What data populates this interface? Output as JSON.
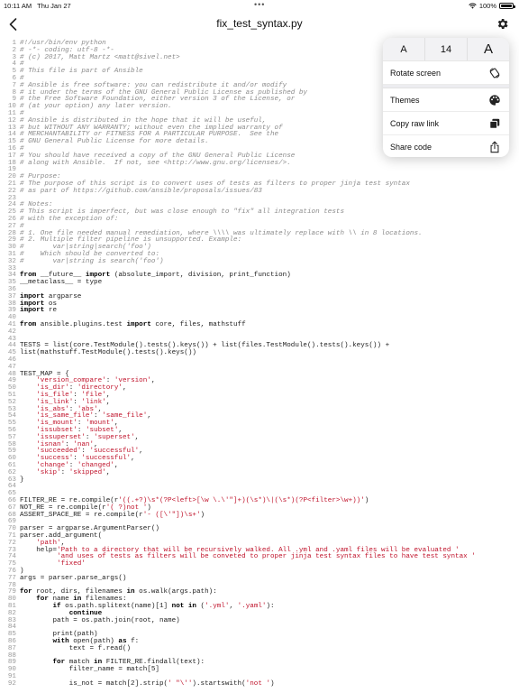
{
  "status_bar": {
    "time": "10:11 AM",
    "date": "Thu Jan 27",
    "battery": "100%"
  },
  "nav": {
    "title": "fix_test_syntax.py"
  },
  "settings_menu": {
    "font_decrease": "A",
    "font_size": "14",
    "font_increase": "A",
    "rotate": "Rotate screen",
    "themes": "Themes",
    "copy_raw": "Copy raw link",
    "share": "Share code"
  },
  "code": {
    "lines": [
      "#!/usr/bin/env python",
      "# -*- coding: utf-8 -*-",
      "# (c) 2017, Matt Martz <matt@sivel.net>",
      "#",
      "# This file is part of Ansible",
      "#",
      "# Ansible is free software: you can redistribute it and/or modify",
      "# it under the terms of the GNU General Public License as published by",
      "# the Free Software Foundation, either version 3 of the License, or",
      "# (at your option) any later version.",
      "#",
      "# Ansible is distributed in the hope that it will be useful,",
      "# but WITHOUT ANY WARRANTY; without even the implied warranty of",
      "# MERCHANTABILITY or FITNESS FOR A PARTICULAR PURPOSE.  See the",
      "# GNU General Public License for more details.",
      "#",
      "# You should have received a copy of the GNU General Public License",
      "# along with Ansible.  If not, see <http://www.gnu.org/licenses/>.",
      "",
      "# Purpose:",
      "# The purpose of this script is to convert uses of tests as filters to proper jinja test syntax",
      "# as part of https://github.com/ansible/proposals/issues/83",
      "",
      "# Notes:",
      "# This script is imperfect, but was close enough to \"fix\" all integration tests",
      "# with the exception of:",
      "#",
      "# 1. One file needed manual remediation, where \\\\\\\\ was ultimately replace with \\\\ in 8 locations.",
      "# 2. Multiple filter pipeline is unsupported. Example:",
      "#       var|string|search('foo')",
      "#    Which should be converted to:",
      "#       var|string is search('foo')",
      "",
      "from __future__ import (absolute_import, division, print_function)",
      "__metaclass__ = type",
      "",
      "import argparse",
      "import os",
      "import re",
      "",
      "from ansible.plugins.test import core, files, mathstuff",
      "",
      "",
      "TESTS = list(core.TestModule().tests().keys()) + list(files.TestModule().tests().keys()) +",
      "list(mathstuff.TestModule().tests().keys())",
      "",
      "",
      "TEST_MAP = {",
      "    'version_compare': 'version',",
      "    'is_dir': 'directory',",
      "    'is_file': 'file',",
      "    'is_link': 'link',",
      "    'is_abs': 'abs',",
      "    'is_same_file': 'same_file',",
      "    'is_mount': 'mount',",
      "    'issubset': 'subset',",
      "    'issuperset': 'superset',",
      "    'isnan': 'nan',",
      "    'succeeded': 'successful',",
      "    'success': 'successful',",
      "    'change': 'changed',",
      "    'skip': 'skipped',",
      "}",
      "",
      "",
      "FILTER_RE = re.compile(r'((.+?)\\s*(?P<left>[\\w \\.\\'\"]+)(\\s*)\\|(\\s*)(?P<filter>\\w+))')",
      "NOT_RE = re.compile(r'( ?)not ')",
      "ASSERT_SPACE_RE = re.compile(r'- ([\\'\"])\\s+')",
      "",
      "parser = argparse.ArgumentParser()",
      "parser.add_argument(",
      "    'path',",
      "    help='Path to a directory that will be recursively walked. All .yml and .yaml files will be evaluated '",
      "         'and uses of tests as filters will be conveted to proper jinja test syntax files to have test syntax '",
      "         'fixed'",
      ")",
      "args = parser.parse_args()",
      "",
      "for root, dirs, filenames in os.walk(args.path):",
      "    for name in filenames:",
      "        if os.path.splitext(name)[1] not in ('.yml', '.yaml'):",
      "            continue",
      "        path = os.path.join(root, name)",
      "",
      "        print(path)",
      "        with open(path) as f:",
      "            text = f.read()",
      "",
      "        for match in FILTER_RE.findall(text):",
      "            filter_name = match[5]",
      "",
      "            is_not = match[2].strip(' \"\\'').startswith('not ')"
    ]
  }
}
